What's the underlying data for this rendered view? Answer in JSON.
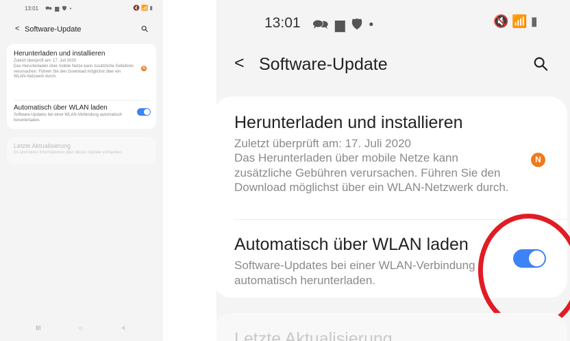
{
  "status": {
    "time": "13:01",
    "left_icons": "🗪 ▆ 🛡 •",
    "right_icons": "🔇 📶 ▮"
  },
  "appbar": {
    "back_glyph": "<",
    "title": "Software-Update"
  },
  "download_item": {
    "title": "Herunterladen und installieren",
    "last_checked": "Zuletzt überprüft am: 17. Juli 2020",
    "description": "Das Herunterladen über mobile Netze kann zusätzliche Gebühren verursachen. Führen Sie den Download möglichst über ein WLAN-Netzwerk durch.",
    "badge": "N"
  },
  "wifi_item": {
    "title": "Automatisch über WLAN laden",
    "description": "Software-Updates bei einer WLAN-Verbindung automatisch herunterladen.",
    "toggle_on": true
  },
  "last_update": {
    "title": "Letzte Aktualisierung",
    "description": "Es sind keine Informationen über dieses Update vorhanden."
  },
  "navbar": {
    "recents": "III",
    "home": "○",
    "back": "<"
  },
  "colors": {
    "accent_blue": "#3e82f7",
    "badge_orange": "#f07a1a",
    "annotation_red": "#e01c24"
  }
}
